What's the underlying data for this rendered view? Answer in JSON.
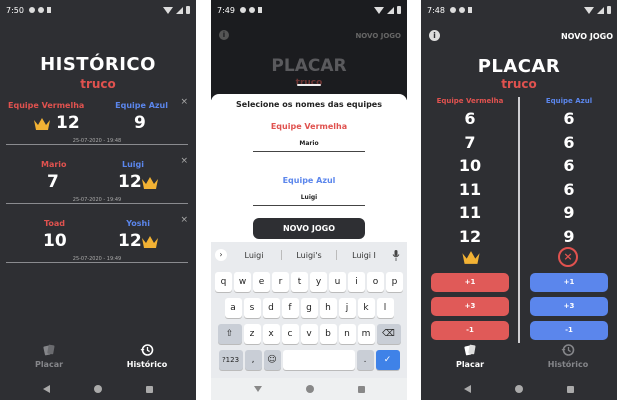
{
  "screen1": {
    "status_time": "7:50",
    "title": "HISTÓRICO",
    "subtitle": "truco",
    "close_glyph": "×",
    "games": [
      {
        "left_name": "Equipe Vermelha",
        "left_score": "12",
        "right_name": "Equipe Azul",
        "right_score": "9",
        "date": "25-07-2020 - 19:48",
        "winner": "left"
      },
      {
        "left_name": "Mario",
        "left_score": "7",
        "right_name": "Luigi",
        "right_score": "12",
        "date": "25-07-2020 - 19:49",
        "winner": "right"
      },
      {
        "left_name": "Toad",
        "left_score": "10",
        "right_name": "Yoshi",
        "right_score": "12",
        "date": "25-07-2020 - 19:49",
        "winner": "right"
      }
    ],
    "tabs": [
      {
        "label": "Placar",
        "icon": "cards-icon",
        "active": false
      },
      {
        "label": "Histórico",
        "icon": "history-icon",
        "active": true
      }
    ]
  },
  "screen2": {
    "status_time": "7:49",
    "bg_new_game": "NOVO JOGO",
    "bg_title": "PLACAR",
    "bg_subtitle": "truco",
    "sheet_title": "Selecione os nomes das equipes",
    "team1_label": "Equipe Vermelha",
    "team1_value": "Mario",
    "team2_label": "Equipe Azul",
    "team2_value": "Luigi",
    "button": "NOVO JOGO",
    "suggestions": [
      "Luigi",
      "Luigi's",
      "Luigi I"
    ],
    "keyboard": {
      "row1": [
        "q",
        "w",
        "e",
        "r",
        "t",
        "y",
        "u",
        "i",
        "o",
        "p"
      ],
      "row2": [
        "a",
        "s",
        "d",
        "f",
        "g",
        "h",
        "j",
        "k",
        "l"
      ],
      "row3": [
        "z",
        "x",
        "c",
        "v",
        "b",
        "n",
        "m"
      ],
      "sym": "?123",
      "comma": ",",
      "emoji": "☺",
      "period": "."
    }
  },
  "screen3": {
    "status_time": "7:48",
    "new_game": "NOVO JOGO",
    "title": "PLACAR",
    "subtitle": "truco",
    "left_team": "Equipe Vermelha",
    "right_team": "Equipe Azul",
    "left_scores": [
      "6",
      "7",
      "10",
      "11",
      "11",
      "12"
    ],
    "right_scores": [
      "6",
      "6",
      "6",
      "6",
      "9",
      "9"
    ],
    "buttons": [
      "+1",
      "+3",
      "-1"
    ],
    "tabs": [
      {
        "label": "Placar",
        "icon": "cards-icon",
        "active": true
      },
      {
        "label": "Histórico",
        "icon": "history-icon",
        "active": false
      }
    ]
  },
  "colors": {
    "red": "#e0524f",
    "blue": "#5b86ec",
    "gold": "#f2b234",
    "bg": "#2e2f33"
  }
}
